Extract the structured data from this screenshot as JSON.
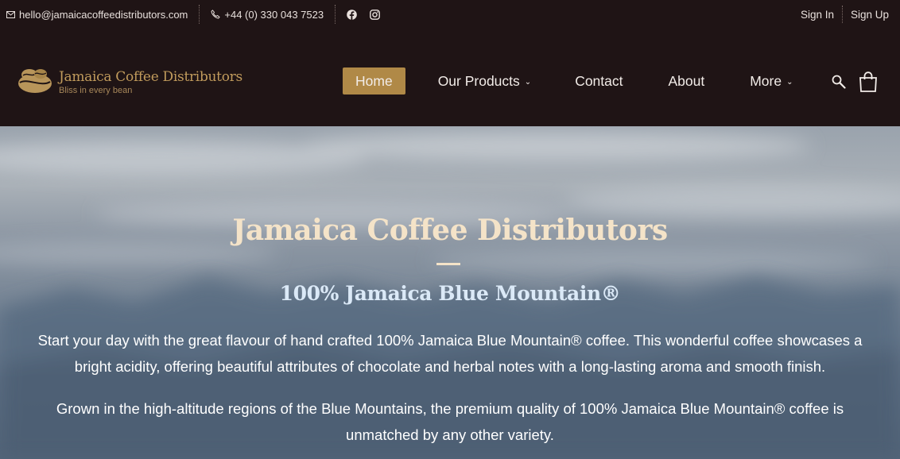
{
  "topbar": {
    "email": "hello@jamaicacoffeedistributors.com",
    "phone": "+44 (0) 330 043 7523",
    "social": [
      "facebook-icon",
      "instagram-icon"
    ],
    "sign_in": "Sign In",
    "sign_up": "Sign Up"
  },
  "logo": {
    "name": "Jamaica Coffee Distributors",
    "tagline": "Bliss in every bean"
  },
  "nav": {
    "items": [
      {
        "label": "Home",
        "active": true
      },
      {
        "label": "Our Products",
        "dropdown": true
      },
      {
        "label": "Contact"
      },
      {
        "label": "About"
      },
      {
        "label": "More",
        "dropdown": true
      }
    ],
    "chevron": "⌄",
    "icons": [
      "search-icon",
      "cart-icon"
    ]
  },
  "hero": {
    "title": "Jamaica Coffee Distributors",
    "subtitle": "100% Jamaica Blue Mountain®",
    "paragraph1": "Start your day with the great flavour of hand crafted 100% Jamaica Blue Mountain® coffee. This wonderful coffee showcases a bright acidity, offering beautiful attributes of chocolate and herbal notes with a long-lasting aroma and smooth finish.",
    "paragraph2": "Grown in the high-altitude regions of the Blue Mountains, the premium quality of 100% Jamaica Blue Mountain® coffee is unmatched by any other variety."
  },
  "colors": {
    "header_bg": "#1f1415",
    "accent": "#b08947",
    "logo_gold": "#c19b5c",
    "hero_title": "#f4e3c8",
    "hero_subtitle": "#dbe9f7"
  }
}
